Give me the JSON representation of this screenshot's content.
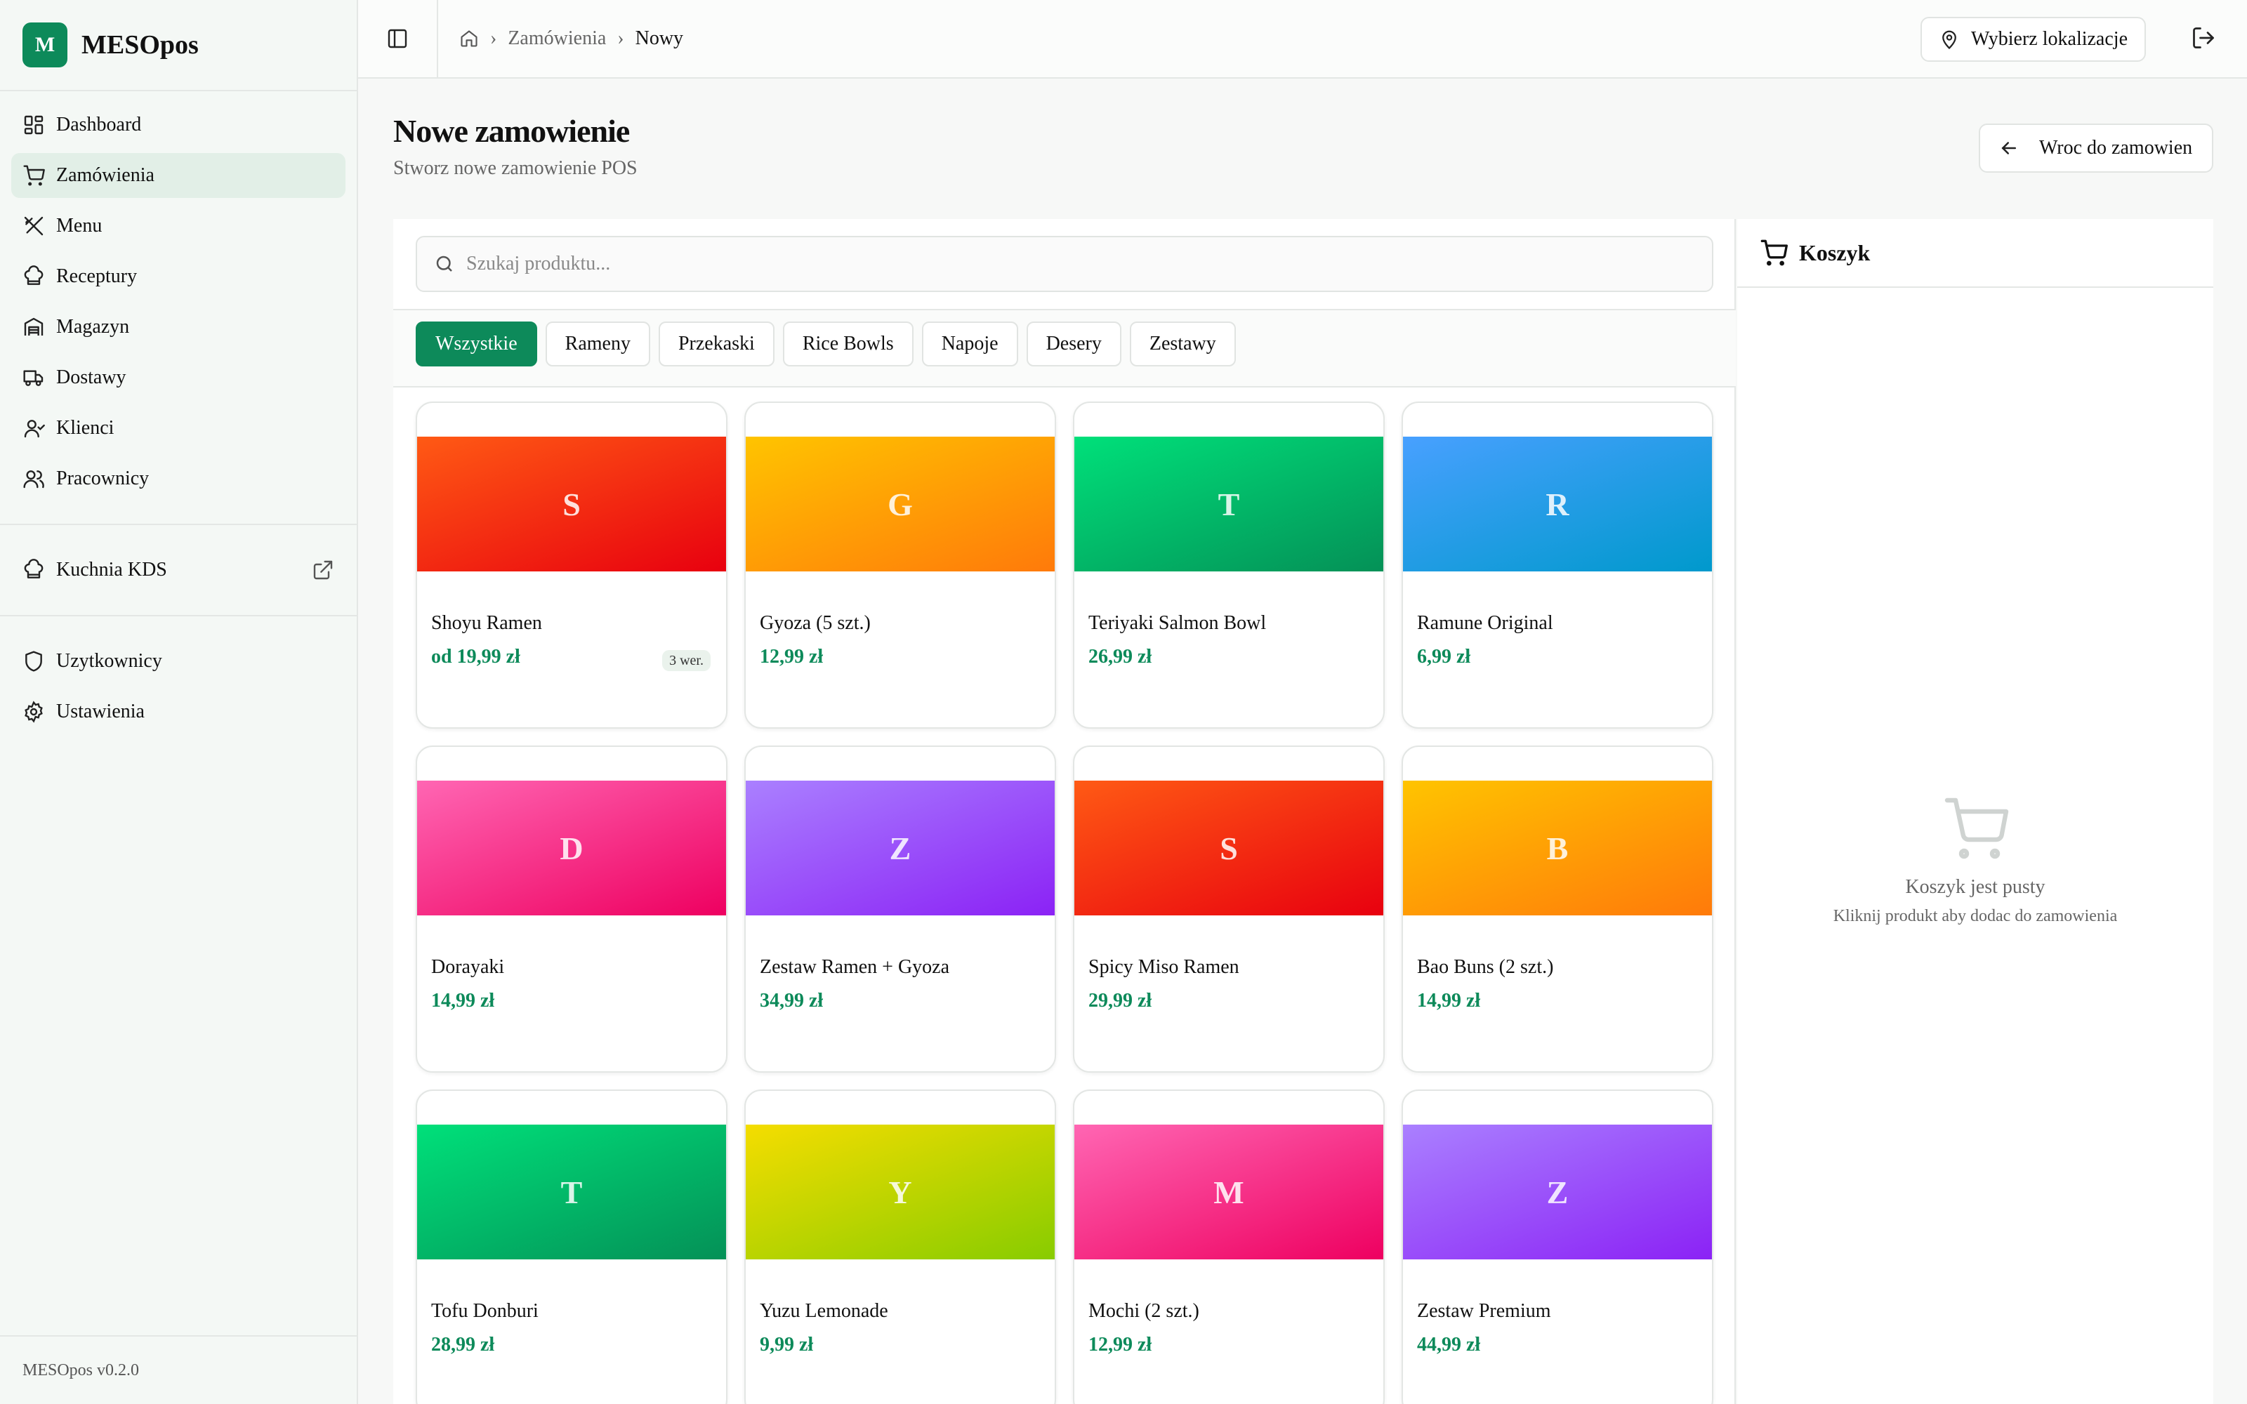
{
  "brand": {
    "logo_letter": "M",
    "name": "MESOpos"
  },
  "sidebar": {
    "items": [
      {
        "label": "Dashboard",
        "icon": "dashboard-icon"
      },
      {
        "label": "Zamówienia",
        "icon": "cart-icon",
        "active": true
      },
      {
        "label": "Menu",
        "icon": "utensils-icon"
      },
      {
        "label": "Receptury",
        "icon": "chef-hat-icon"
      },
      {
        "label": "Magazyn",
        "icon": "warehouse-icon"
      },
      {
        "label": "Dostawy",
        "icon": "truck-icon"
      },
      {
        "label": "Klienci",
        "icon": "user-icon"
      },
      {
        "label": "Pracownicy",
        "icon": "users-icon"
      }
    ],
    "kds": {
      "label": "Kuchnia KDS",
      "icon": "chef-hat-icon"
    },
    "admin": [
      {
        "label": "Uzytkownicy",
        "icon": "shield-icon"
      },
      {
        "label": "Ustawienia",
        "icon": "gear-icon"
      }
    ],
    "footer": "MESOpos v0.2.0"
  },
  "topbar": {
    "breadcrumb": [
      "Zamówienia",
      "Nowy"
    ],
    "location_button": "Wybierz lokalizacje"
  },
  "page": {
    "title": "Nowe zamowienie",
    "subtitle": "Stworz nowe zamowienie POS",
    "back_button": "Wroc do zamowien"
  },
  "search": {
    "placeholder": "Szukaj produktu..."
  },
  "categories": [
    "Wszystkie",
    "Rameny",
    "Przekaski",
    "Rice Bowls",
    "Napoje",
    "Desery",
    "Zestawy"
  ],
  "active_category": "Wszystkie",
  "colors": {
    "accent": "#0d8a5a",
    "red": [
      "#ff5a14",
      "#e8000f"
    ],
    "orange": [
      "#ffc400",
      "#ff7a0a"
    ],
    "green": [
      "#00e07a",
      "#049157"
    ],
    "blue": [
      "#48a0ff",
      "#0099cc"
    ],
    "pink": [
      "#ff66b3",
      "#ee0060"
    ],
    "purple": [
      "#aa80ff",
      "#8b22f5"
    ],
    "lime": [
      "#f5dd00",
      "#88cc00"
    ]
  },
  "products": [
    {
      "letter": "S",
      "name": "Shoyu Ramen",
      "price": "od 19,99 zł",
      "badge": "3 wer.",
      "color": "red"
    },
    {
      "letter": "G",
      "name": "Gyoza (5 szt.)",
      "price": "12,99 zł",
      "color": "orange"
    },
    {
      "letter": "T",
      "name": "Teriyaki Salmon Bowl",
      "price": "26,99 zł",
      "color": "green"
    },
    {
      "letter": "R",
      "name": "Ramune Original",
      "price": "6,99 zł",
      "color": "blue"
    },
    {
      "letter": "D",
      "name": "Dorayaki",
      "price": "14,99 zł",
      "color": "pink"
    },
    {
      "letter": "Z",
      "name": "Zestaw Ramen + Gyoza",
      "price": "34,99 zł",
      "color": "purple"
    },
    {
      "letter": "S",
      "name": "Spicy Miso Ramen",
      "price": "29,99 zł",
      "color": "red"
    },
    {
      "letter": "B",
      "name": "Bao Buns (2 szt.)",
      "price": "14,99 zł",
      "color": "orange"
    },
    {
      "letter": "T",
      "name": "Tofu Donburi",
      "price": "28,99 zł",
      "color": "green"
    },
    {
      "letter": "Y",
      "name": "Yuzu Lemonade",
      "price": "9,99 zł",
      "color": "lime"
    },
    {
      "letter": "M",
      "name": "Mochi (2 szt.)",
      "price": "12,99 zł",
      "color": "pink"
    },
    {
      "letter": "Z",
      "name": "Zestaw Premium",
      "price": "44,99 zł",
      "color": "purple"
    }
  ],
  "cart": {
    "title": "Koszyk",
    "empty_title": "Koszyk jest pusty",
    "empty_subtitle": "Kliknij produkt aby dodac do zamowienia"
  }
}
